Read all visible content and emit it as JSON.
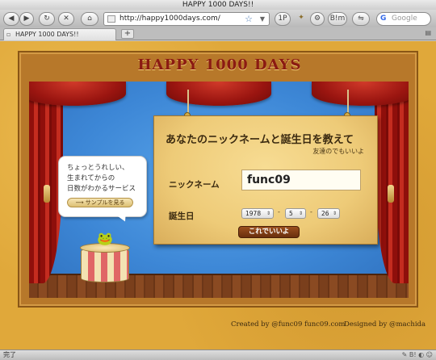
{
  "window": {
    "title": "HAPPY 1000 DAYS!!"
  },
  "toolbar": {
    "url": "http://happy1000days.com/",
    "search_placeholder": "Google",
    "back_icon": "back-arrow-icon",
    "forward_icon": "forward-arrow-icon",
    "reload_icon": "reload-icon",
    "stop_icon": "stop-icon",
    "home_icon": "home-icon",
    "button_1p": "1P",
    "button_bm": "B!m"
  },
  "tabs": [
    {
      "label": "HAPPY 1000 DAYS!!"
    }
  ],
  "page": {
    "site_title": "HAPPY 1000 DAYS",
    "bubble": {
      "line1": "ちょっとうれしい、",
      "line2": "生まれてからの",
      "line3": "日数がわかるサービス",
      "sample_link": "サンプルを見る"
    },
    "form": {
      "title": "あなたのニックネームと誕生日を教えて",
      "subtitle": "友達のでもいいよ",
      "nickname_label": "ニックネーム",
      "nickname_value": "func09",
      "birthday_label": "誕生日",
      "year": "1978",
      "month": "5",
      "day": "26",
      "separator": "-",
      "submit_label": "これでいいよ"
    },
    "footer": {
      "credit": "Created by @func09 func09.com",
      "design": "Designed by @machida"
    }
  },
  "statusbar": {
    "text": "完了"
  },
  "colors": {
    "title_red": "#8b1a12",
    "stage_blue": "#3d87d6",
    "board": "#eecb78",
    "submit_brown": "#7a3a12"
  }
}
